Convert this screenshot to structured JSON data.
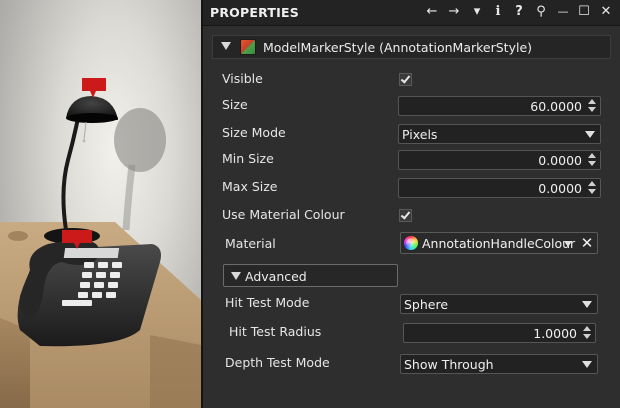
{
  "panel": {
    "title": "PROPERTIES",
    "toolbar": [
      {
        "name": "back-icon",
        "glyph": "←"
      },
      {
        "name": "forward-icon",
        "glyph": "→"
      },
      {
        "name": "dropdown-icon",
        "glyph": "▾"
      },
      {
        "name": "info-icon",
        "glyph": "i"
      },
      {
        "name": "help-icon",
        "glyph": "?"
      },
      {
        "name": "pin-icon",
        "glyph": "⚲"
      },
      {
        "name": "minimize-icon",
        "glyph": "—"
      },
      {
        "name": "maximize-icon",
        "glyph": "☐"
      },
      {
        "name": "close-icon",
        "glyph": "✕"
      }
    ]
  },
  "header": {
    "title": "ModelMarkerStyle (AnnotationMarkerStyle)",
    "icon": "cube-icon"
  },
  "properties": {
    "visible": {
      "label": "Visible",
      "checked": true
    },
    "size": {
      "label": "Size",
      "value": "60.0000"
    },
    "size_mode": {
      "label": "Size Mode",
      "value": "Pixels"
    },
    "min_size": {
      "label": "Min Size",
      "value": "0.0000"
    },
    "max_size": {
      "label": "Max Size",
      "value": "0.0000"
    },
    "use_material_colour": {
      "label": "Use Material Colour",
      "checked": true
    },
    "material": {
      "label": "Material",
      "value": "AnnotationHandleColour",
      "clear_glyph": "✕"
    }
  },
  "advanced": {
    "label": "Advanced",
    "hit_test_mode": {
      "label": "Hit Test Mode",
      "value": "Sphere"
    },
    "hit_test_radius": {
      "label": "Hit Test Radius",
      "value": "1.0000"
    },
    "depth_test_mode": {
      "label": "Depth Test Mode",
      "value": "Show Through"
    }
  },
  "colors": {
    "panel_bg": "#2e2e2e",
    "titlebar_bg": "#232323",
    "field_bg": "#222222",
    "text": "#e6e6e6",
    "marker_red": "#cc1a1a"
  }
}
